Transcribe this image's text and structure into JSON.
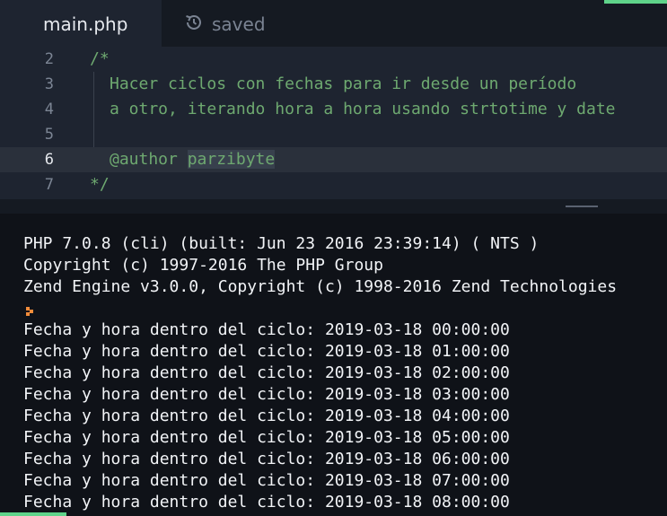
{
  "tabs": {
    "active": {
      "label": "main.php"
    },
    "status": {
      "label": "saved",
      "icon": "history-icon"
    }
  },
  "editor": {
    "lines": [
      {
        "number": "2",
        "text": "/*"
      },
      {
        "number": "3",
        "text": "Hacer ciclos con fechas para ir desde un período"
      },
      {
        "number": "4",
        "text": "a otro, iterando hora a hora usando strtotime y date"
      },
      {
        "number": "5",
        "text": ""
      },
      {
        "number": "6",
        "text_tag": "@author",
        "text_value": "parzibyte"
      },
      {
        "number": "7",
        "text": "*/"
      }
    ],
    "current_line": "6"
  },
  "console": {
    "header": [
      "PHP 7.0.8 (cli) (built: Jun 23 2016 23:39:14) ( NTS )",
      "Copyright (c) 1997-2016 The PHP Group",
      "Zend Engine v3.0.0, Copyright (c) 1998-2016 Zend Technologies"
    ],
    "prompt_icon": "prompt-chevron-icon",
    "output": [
      "Fecha y hora dentro del ciclo: 2019-03-18 00:00:00",
      "Fecha y hora dentro del ciclo: 2019-03-18 01:00:00",
      "Fecha y hora dentro del ciclo: 2019-03-18 02:00:00",
      "Fecha y hora dentro del ciclo: 2019-03-18 03:00:00",
      "Fecha y hora dentro del ciclo: 2019-03-18 04:00:00",
      "Fecha y hora dentro del ciclo: 2019-03-18 05:00:00",
      "Fecha y hora dentro del ciclo: 2019-03-18 06:00:00",
      "Fecha y hora dentro del ciclo: 2019-03-18 07:00:00",
      "Fecha y hora dentro del ciclo: 2019-03-18 08:00:00"
    ]
  },
  "colors": {
    "accent": "#5fd38a",
    "comment": "#6ea970",
    "prompt": "#f28c3a"
  }
}
